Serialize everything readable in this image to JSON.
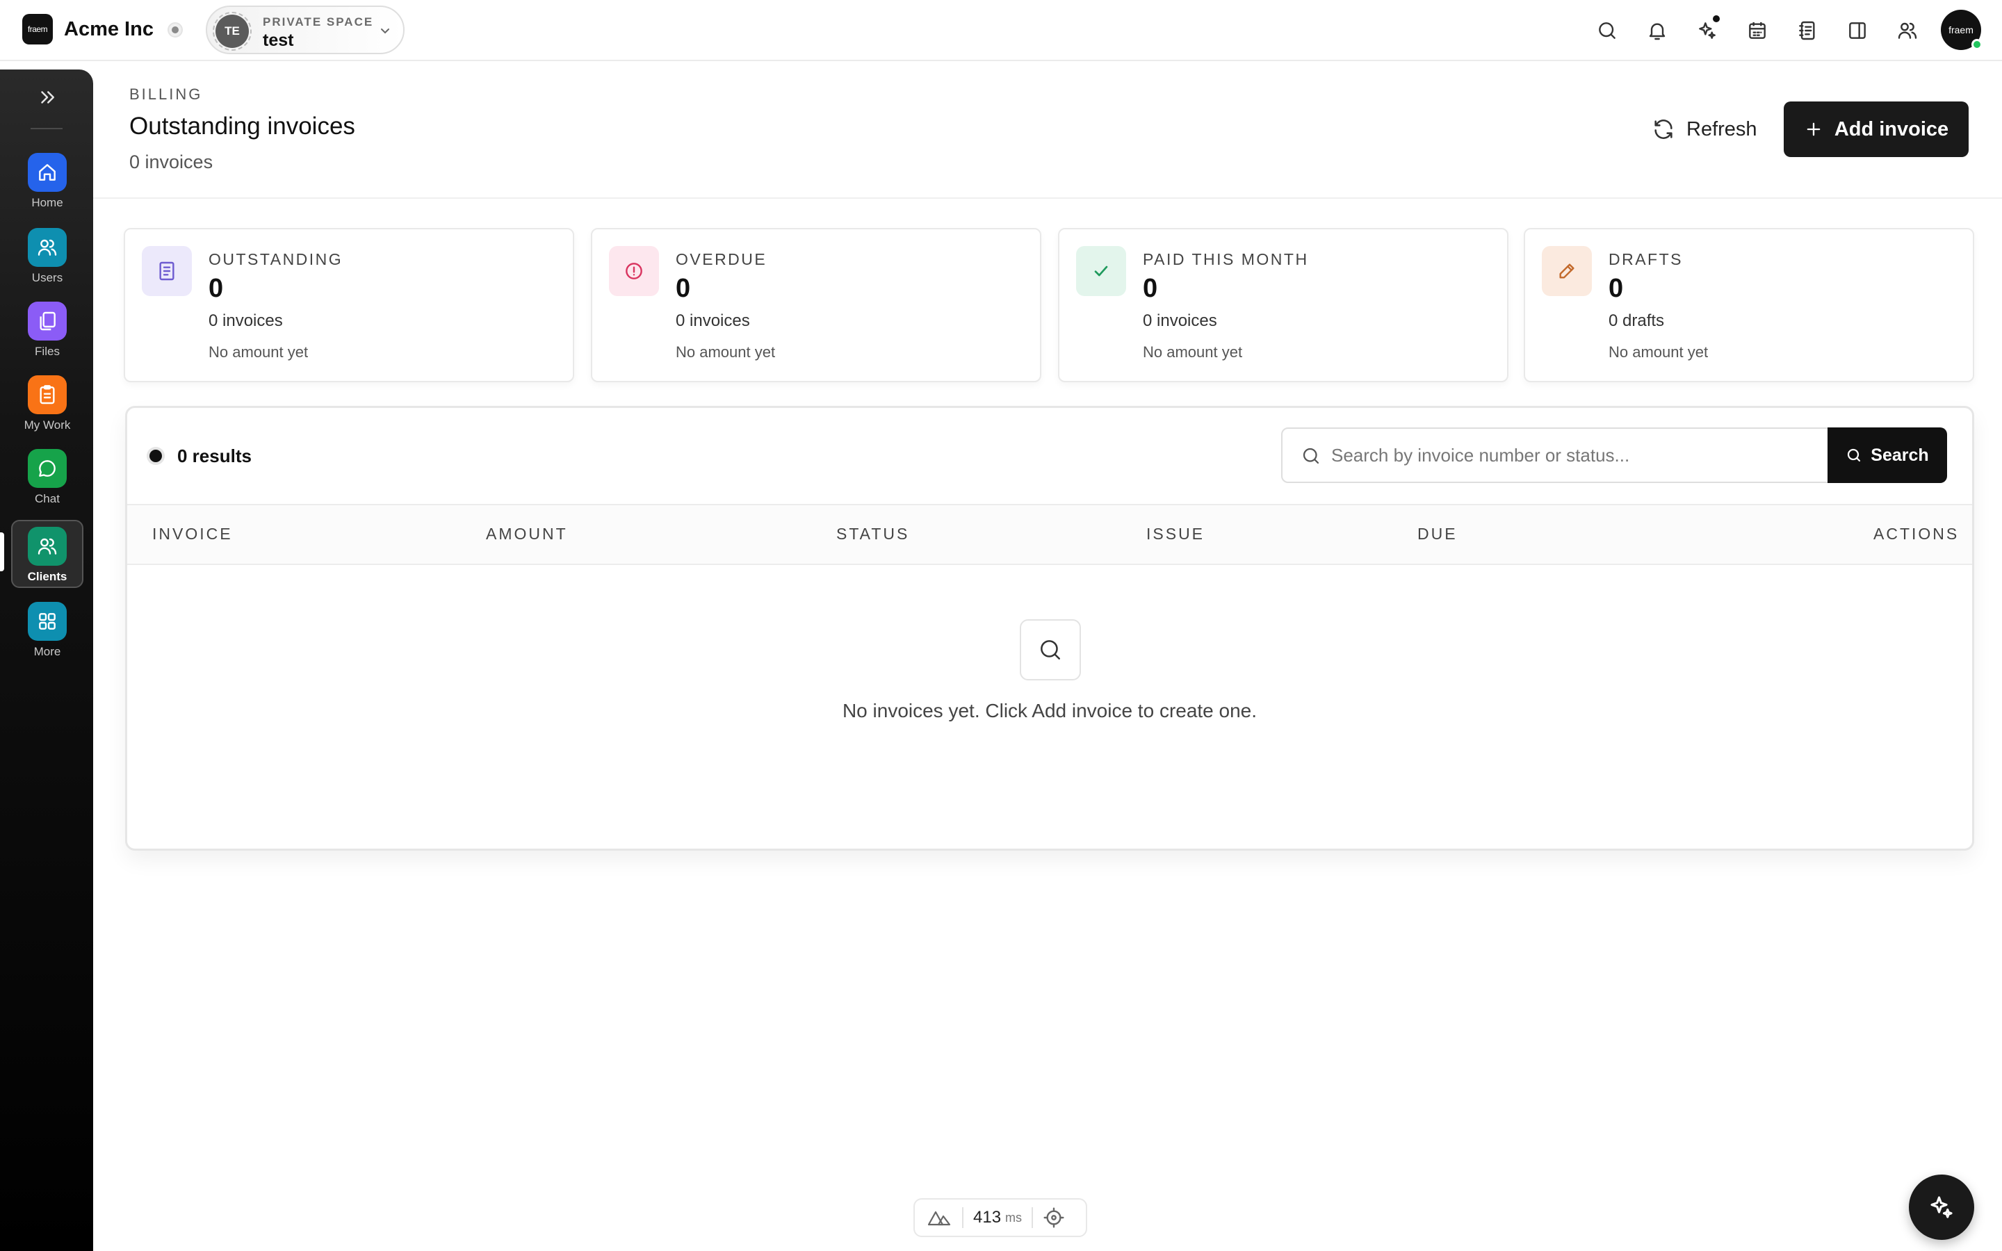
{
  "app": {
    "logo_text": "fraem",
    "org_name": "Acme Inc"
  },
  "space": {
    "avatar": "TE",
    "kicker": "PRIVATE SPACE",
    "name": "test"
  },
  "topbar": {
    "icons": [
      "search-icon",
      "bell-icon",
      "sparkle-icon",
      "calendar-icon",
      "notebook-icon",
      "panel-icon",
      "people-icon"
    ],
    "avatar_text": "fraem"
  },
  "sidebar": {
    "items": [
      {
        "label": "Home",
        "icon": "home-icon",
        "color": "#2563eb"
      },
      {
        "label": "Users",
        "icon": "users-icon",
        "color": "#0e8fb0"
      },
      {
        "label": "Files",
        "icon": "files-icon",
        "color": "#8b5cf6"
      },
      {
        "label": "My Work",
        "icon": "clipboard-icon",
        "color": "#f97316"
      },
      {
        "label": "Chat",
        "icon": "chat-icon",
        "color": "#16a34a"
      },
      {
        "label": "Clients",
        "icon": "clients-icon",
        "color": "#10936b",
        "active": true
      },
      {
        "label": "More",
        "icon": "grid-icon",
        "color": "#0e8fb0"
      }
    ]
  },
  "header": {
    "kicker": "BILLING",
    "title": "Outstanding invoices",
    "subtitle": "0 invoices",
    "refresh_label": "Refresh",
    "add_label": "Add invoice"
  },
  "stats": [
    {
      "label": "OUTSTANDING",
      "value": "0",
      "count": "0 invoices",
      "amount": "No amount yet",
      "icon": "invoice-icon",
      "bg": "#ece9fb",
      "fg": "#6d5bd0"
    },
    {
      "label": "OVERDUE",
      "value": "0",
      "count": "0 invoices",
      "amount": "No amount yet",
      "icon": "alert-icon",
      "bg": "#fde7ee",
      "fg": "#d9345f"
    },
    {
      "label": "PAID THIS MONTH",
      "value": "0",
      "count": "0 invoices",
      "amount": "No amount yet",
      "icon": "check-icon",
      "bg": "#e3f5ec",
      "fg": "#1f9a5c"
    },
    {
      "label": "DRAFTS",
      "value": "0",
      "count": "0 drafts",
      "amount": "No amount yet",
      "icon": "pencil-icon",
      "bg": "#fbeadf",
      "fg": "#c2692b"
    }
  ],
  "results": {
    "count_label": "0 results",
    "search_placeholder": "Search by invoice number or status...",
    "search_button": "Search",
    "columns": [
      "INVOICE",
      "AMOUNT",
      "STATUS",
      "ISSUE",
      "DUE",
      "ACTIONS"
    ],
    "empty_message": "No invoices yet. Click Add invoice to create one."
  },
  "perf": {
    "value": "413",
    "unit": "ms"
  }
}
